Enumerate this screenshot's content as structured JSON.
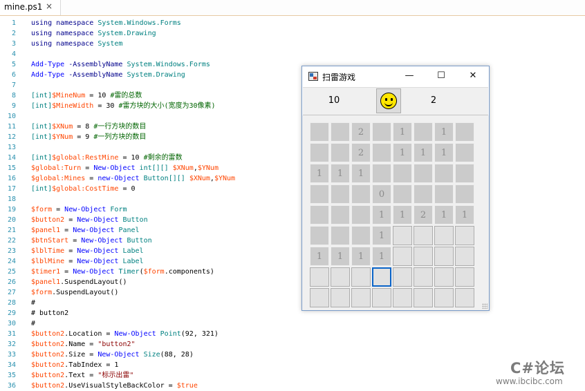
{
  "tab": {
    "title": "mine.ps1",
    "close_glyph": "×"
  },
  "editor": {
    "lines": [
      [
        [
          "kw",
          "using namespace "
        ],
        [
          "typ",
          "System.Windows.Forms"
        ]
      ],
      [
        [
          "kw",
          "using namespace "
        ],
        [
          "typ",
          "System.Drawing"
        ]
      ],
      [
        [
          "kw",
          "using namespace "
        ],
        [
          "typ",
          "System"
        ]
      ],
      [],
      [
        [
          "cmd",
          "Add-Type "
        ],
        [
          "kw",
          "-AssemblyName "
        ],
        [
          "typ",
          "System.Windows.Forms"
        ]
      ],
      [
        [
          "cmd",
          "Add-Type "
        ],
        [
          "kw",
          "-AssemblyName "
        ],
        [
          "typ",
          "System.Drawing"
        ]
      ],
      [],
      [
        [
          "typ",
          "[int]"
        ],
        [
          "var",
          "$MineNum"
        ],
        [
          "pl",
          " = "
        ],
        [
          "pl",
          "10 "
        ],
        [
          "cm",
          "#雷的总数"
        ]
      ],
      [
        [
          "typ",
          "[int]"
        ],
        [
          "var",
          "$MineWidth"
        ],
        [
          "pl",
          " = "
        ],
        [
          "pl",
          "30 "
        ],
        [
          "cm",
          "#雷方块的大小(宽度为30像素)"
        ]
      ],
      [],
      [
        [
          "typ",
          "[int]"
        ],
        [
          "var",
          "$XNum"
        ],
        [
          "pl",
          " = "
        ],
        [
          "pl",
          "8 "
        ],
        [
          "cm",
          "#一行方块的数目"
        ]
      ],
      [
        [
          "typ",
          "[int]"
        ],
        [
          "var",
          "$YNum"
        ],
        [
          "pl",
          " = "
        ],
        [
          "pl",
          "9 "
        ],
        [
          "cm",
          "#一列方块的数目"
        ]
      ],
      [],
      [
        [
          "typ",
          "[int]"
        ],
        [
          "var",
          "$global:RestMine"
        ],
        [
          "pl",
          " = "
        ],
        [
          "pl",
          "10 "
        ],
        [
          "cm",
          "#剩余的雷数"
        ]
      ],
      [
        [
          "var",
          "$global:Turn"
        ],
        [
          "pl",
          " = "
        ],
        [
          "cmd",
          "New-Object "
        ],
        [
          "typ",
          "int[][] "
        ],
        [
          "var",
          "$XNum"
        ],
        [
          "pl",
          ","
        ],
        [
          "var",
          "$YNum"
        ]
      ],
      [
        [
          "var",
          "$global:Mines"
        ],
        [
          "pl",
          " = "
        ],
        [
          "cmd",
          "new-Object "
        ],
        [
          "typ",
          "Button[][] "
        ],
        [
          "var",
          "$XNum"
        ],
        [
          "pl",
          ","
        ],
        [
          "var",
          "$YNum"
        ]
      ],
      [
        [
          "typ",
          "[int]"
        ],
        [
          "var",
          "$global:CostTime"
        ],
        [
          "pl",
          " = "
        ],
        [
          "pl",
          "0"
        ]
      ],
      [],
      [
        [
          "var",
          "$form"
        ],
        [
          "pl",
          " = "
        ],
        [
          "cmd",
          "New-Object "
        ],
        [
          "typ",
          "Form"
        ]
      ],
      [
        [
          "var",
          "$button2"
        ],
        [
          "pl",
          " = "
        ],
        [
          "cmd",
          "New-Object "
        ],
        [
          "typ",
          "Button"
        ]
      ],
      [
        [
          "var",
          "$panel1"
        ],
        [
          "pl",
          " = "
        ],
        [
          "cmd",
          "New-Object "
        ],
        [
          "typ",
          "Panel"
        ]
      ],
      [
        [
          "var",
          "$btnStart"
        ],
        [
          "pl",
          " = "
        ],
        [
          "cmd",
          "New-Object "
        ],
        [
          "typ",
          "Button"
        ]
      ],
      [
        [
          "var",
          "$lblTime"
        ],
        [
          "pl",
          " = "
        ],
        [
          "cmd",
          "New-Object "
        ],
        [
          "typ",
          "Label"
        ]
      ],
      [
        [
          "var",
          "$lblMine"
        ],
        [
          "pl",
          " = "
        ],
        [
          "cmd",
          "New-Object "
        ],
        [
          "typ",
          "Label"
        ]
      ],
      [
        [
          "var",
          "$timer1"
        ],
        [
          "pl",
          " = "
        ],
        [
          "cmd",
          "New-Object "
        ],
        [
          "typ",
          "Timer"
        ],
        [
          "pl",
          "("
        ],
        [
          "var",
          "$form"
        ],
        [
          "pl",
          ".components)"
        ]
      ],
      [
        [
          "var",
          "$panel1"
        ],
        [
          "pl",
          ".SuspendLayout()"
        ]
      ],
      [
        [
          "var",
          "$form"
        ],
        [
          "pl",
          ".SuspendLayout()"
        ]
      ],
      [
        [
          "pl",
          "#"
        ]
      ],
      [
        [
          "pl",
          "# button2"
        ]
      ],
      [
        [
          "pl",
          "#"
        ]
      ],
      [
        [
          "var",
          "$button2"
        ],
        [
          "pl",
          ".Location = "
        ],
        [
          "cmd",
          "New-Object "
        ],
        [
          "typ",
          "Point"
        ],
        [
          "pl",
          "(92, 321)"
        ]
      ],
      [
        [
          "var",
          "$button2"
        ],
        [
          "pl",
          ".Name = "
        ],
        [
          "str",
          "\"button2\""
        ]
      ],
      [
        [
          "var",
          "$button2"
        ],
        [
          "pl",
          ".Size = "
        ],
        [
          "cmd",
          "New-Object "
        ],
        [
          "typ",
          "Size"
        ],
        [
          "pl",
          "(88, 28)"
        ]
      ],
      [
        [
          "var",
          "$button2"
        ],
        [
          "pl",
          ".TabIndex = 1"
        ]
      ],
      [
        [
          "var",
          "$button2"
        ],
        [
          "pl",
          ".Text = "
        ],
        [
          "str",
          "\"标示出雷\""
        ]
      ],
      [
        [
          "var",
          "$button2"
        ],
        [
          "pl",
          ".UseVisualStyleBackColor = "
        ],
        [
          "var",
          "$true"
        ]
      ]
    ]
  },
  "game_window": {
    "title": "扫雷游戏",
    "buttons": {
      "minimize": "—",
      "maximize": "☐",
      "close": "✕"
    },
    "mine_count": "10",
    "timer": "2",
    "start_button_icon": "smiley-face-icon",
    "board": {
      "cols": 8,
      "rows": 9,
      "cells": [
        [
          "R",
          "R",
          "R2",
          "R",
          "R1",
          "R",
          "R1",
          "R"
        ],
        [
          "R",
          "R",
          "R2",
          "R",
          "R1",
          "R1",
          "R1",
          "R"
        ],
        [
          "R1",
          "R1",
          "R1",
          "R",
          "R",
          "R",
          "R",
          "R"
        ],
        [
          "R",
          "R",
          "R",
          "R0",
          "R",
          "R",
          "R",
          "R"
        ],
        [
          "R",
          "R",
          "R",
          "R1",
          "R1",
          "R2",
          "R1",
          "R1"
        ],
        [
          "R",
          "R",
          "R",
          "R1",
          "H",
          "H",
          "H",
          "H"
        ],
        [
          "R1",
          "R1",
          "R1",
          "R1",
          "H",
          "H",
          "H",
          "H"
        ],
        [
          "H",
          "H",
          "H",
          "F",
          "H",
          "H",
          "H",
          "H"
        ],
        [
          "H",
          "H",
          "H",
          "H",
          "H",
          "H",
          "H",
          "H"
        ]
      ]
    }
  },
  "watermark": {
    "brand": "C#论坛",
    "url": "www.ibcibc.com"
  }
}
